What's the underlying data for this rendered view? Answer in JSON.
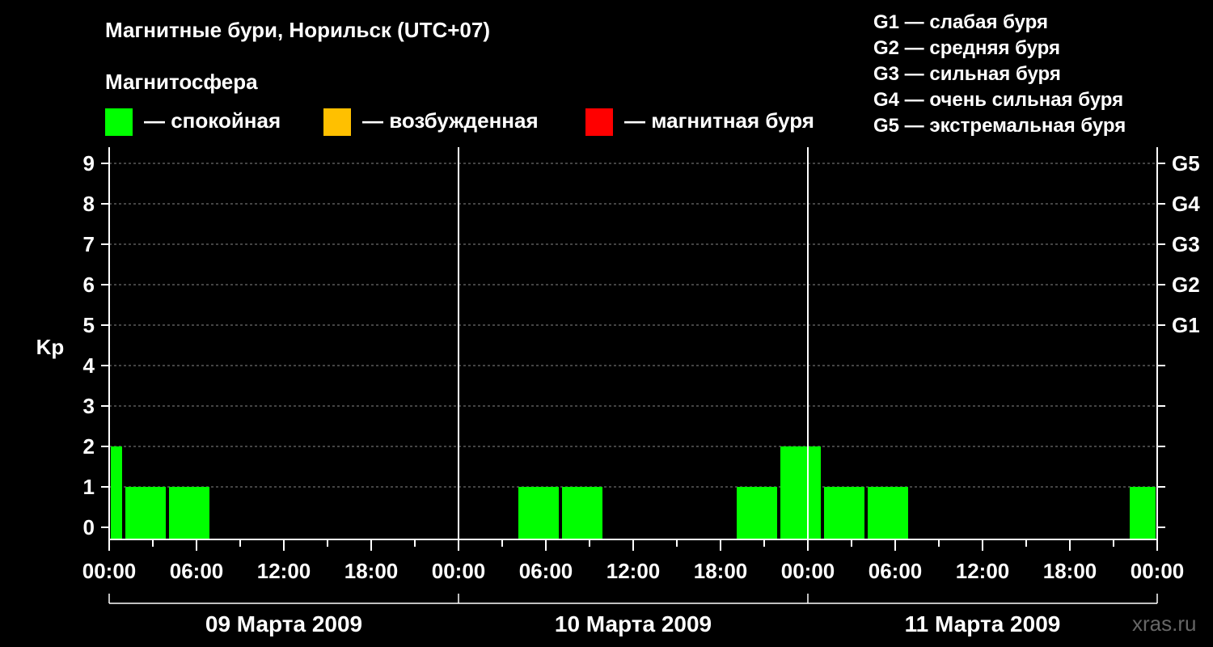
{
  "title": "Магнитные бури, Норильск (UTC+07)",
  "subtitle": "Магнитосфера",
  "legend": [
    {
      "label": "— спокойная",
      "color": "#00ff00"
    },
    {
      "label": "— возбужденная",
      "color": "#ffc000"
    },
    {
      "label": "— магнитная буря",
      "color": "#ff0000"
    }
  ],
  "g_legend": [
    "G1 — слабая буря",
    "G2 — средняя буря",
    "G3 — сильная буря",
    "G4 — очень сильная буря",
    "G5 — экстремальная буря"
  ],
  "watermark": "xras.ru",
  "chart_data": {
    "type": "bar",
    "ylabel": "Kp",
    "ylim": [
      0,
      9
    ],
    "y_ticks": [
      "0",
      "1",
      "2",
      "3",
      "4",
      "5",
      "6",
      "7",
      "8",
      "9"
    ],
    "right_ticks": [
      {
        "value": 5,
        "label": "G1"
      },
      {
        "value": 6,
        "label": "G2"
      },
      {
        "value": 7,
        "label": "G3"
      },
      {
        "value": 8,
        "label": "G4"
      },
      {
        "value": 9,
        "label": "G5"
      }
    ],
    "x_tick_labels": [
      "00:00",
      "06:00",
      "12:00",
      "18:00",
      "00:00",
      "06:00",
      "12:00",
      "18:00",
      "00:00",
      "06:00",
      "12:00",
      "18:00",
      "00:00"
    ],
    "x_range_hours": [
      0,
      72
    ],
    "days": [
      "09 Марта 2009",
      "10 Марта 2009",
      "11 Марта 2009"
    ],
    "grid": "dashed horizontal",
    "bars": [
      {
        "start_hour": 0,
        "end_hour": 1,
        "kp": 2,
        "status": "спокойная"
      },
      {
        "start_hour": 1,
        "end_hour": 4,
        "kp": 1,
        "status": "спокойная"
      },
      {
        "start_hour": 4,
        "end_hour": 7,
        "kp": 1,
        "status": "спокойная"
      },
      {
        "start_hour": 28,
        "end_hour": 31,
        "kp": 1,
        "status": "спокойная"
      },
      {
        "start_hour": 31,
        "end_hour": 34,
        "kp": 1,
        "status": "спокойная"
      },
      {
        "start_hour": 43,
        "end_hour": 46,
        "kp": 1,
        "status": "спокойная"
      },
      {
        "start_hour": 46,
        "end_hour": 49,
        "kp": 2,
        "status": "спокойная"
      },
      {
        "start_hour": 49,
        "end_hour": 52,
        "kp": 1,
        "status": "спокойная"
      },
      {
        "start_hour": 52,
        "end_hour": 55,
        "kp": 1,
        "status": "спокойная"
      },
      {
        "start_hour": 70,
        "end_hour": 72,
        "kp": 1,
        "status": "спокойная"
      }
    ]
  }
}
